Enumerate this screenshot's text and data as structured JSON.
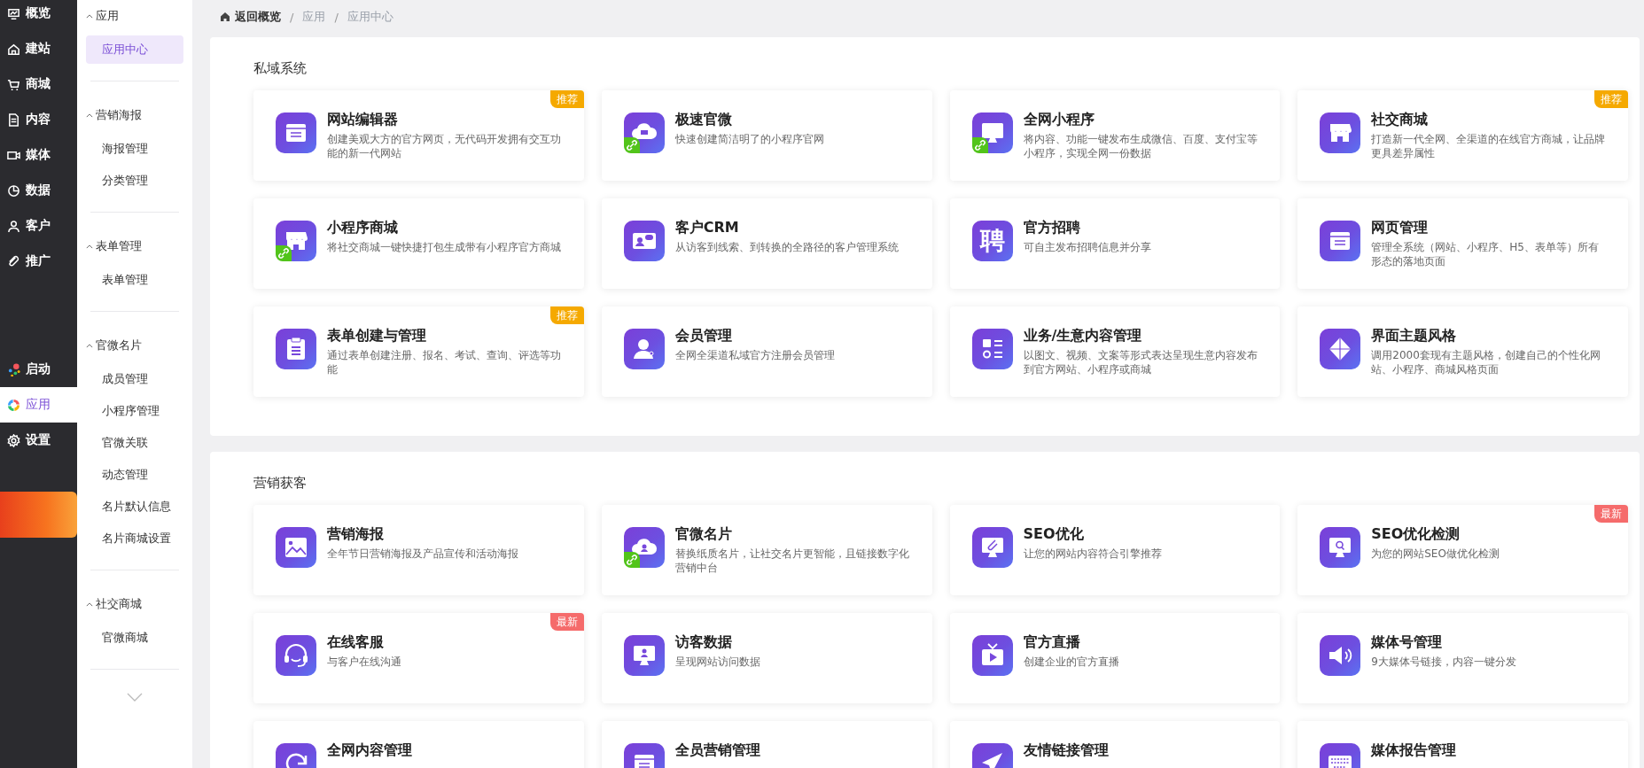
{
  "main_nav": {
    "top": [
      {
        "label": "概览",
        "selected": false
      },
      {
        "label": "建站",
        "selected": false
      },
      {
        "label": "商城",
        "selected": false
      },
      {
        "label": "内容",
        "selected": false
      },
      {
        "label": "媒体",
        "selected": false
      },
      {
        "label": "数据",
        "selected": false
      },
      {
        "label": "客户",
        "selected": false
      },
      {
        "label": "推广",
        "selected": false
      }
    ],
    "bottom": [
      {
        "label": "启动",
        "selected": false
      },
      {
        "label": "应用",
        "selected": true
      },
      {
        "label": "设置",
        "selected": false
      }
    ]
  },
  "sub_nav": [
    {
      "label": "应用",
      "expanded": true,
      "items": [
        {
          "label": "应用中心",
          "selected": true
        }
      ]
    },
    {
      "label": "营销海报",
      "expanded": true,
      "items": [
        {
          "label": "海报管理",
          "selected": false
        },
        {
          "label": "分类管理",
          "selected": false
        }
      ]
    },
    {
      "label": "表单管理",
      "expanded": true,
      "items": [
        {
          "label": "表单管理",
          "selected": false
        }
      ]
    },
    {
      "label": "官微名片",
      "expanded": true,
      "items": [
        {
          "label": "成员管理",
          "selected": false
        },
        {
          "label": "小程序管理",
          "selected": false
        },
        {
          "label": "官微关联",
          "selected": false
        },
        {
          "label": "动态管理",
          "selected": false
        },
        {
          "label": "名片默认信息",
          "selected": false
        },
        {
          "label": "名片商城设置",
          "selected": false
        }
      ]
    },
    {
      "label": "社交商城",
      "expanded": true,
      "items": [
        {
          "label": "官微商城",
          "selected": false
        }
      ]
    }
  ],
  "breadcrumb": {
    "home": "返回概览",
    "separator": "/",
    "items": [
      "应用",
      "应用中心"
    ]
  },
  "sections": [
    {
      "title": "私域系统",
      "cards": [
        {
          "title": "网站编辑器",
          "description": "创建美观大方的官方网页，无代码开发拥有交互功能的新一代网站",
          "badge": {
            "text": "推荐",
            "kind": "recommend"
          },
          "mini_program": false
        },
        {
          "title": "极速官微",
          "description": "快速创建简洁明了的小程序官网",
          "mini_program": true
        },
        {
          "title": "全网小程序",
          "description": "将内容、功能一键发布生成微信、百度、支付宝等小程序，实现全网一份数据",
          "mini_program": true
        },
        {
          "title": "社交商城",
          "description": "打造新一代全网、全渠道的在线官方商城，让品牌更具差异属性",
          "badge": {
            "text": "推荐",
            "kind": "recommend"
          },
          "mini_program": false
        },
        {
          "title": "小程序商城",
          "description": "将社交商城一键快捷打包生成带有小程序官方商城",
          "mini_program": true
        },
        {
          "title": "客户CRM",
          "description": "从访客到线索、到转换的全路径的客户管理系统",
          "mini_program": false
        },
        {
          "title": "官方招聘",
          "description": "可自主发布招聘信息并分享",
          "icon_glyph": "聘",
          "mini_program": false
        },
        {
          "title": "网页管理",
          "description": "管理全系统（网站、小程序、H5、表单等）所有形态的落地页面",
          "mini_program": false
        },
        {
          "title": "表单创建与管理",
          "description": "通过表单创建注册、报名、考试、查询、评选等功能",
          "badge": {
            "text": "推荐",
            "kind": "recommend"
          },
          "mini_program": false
        },
        {
          "title": "会员管理",
          "description": "全网全渠道私域官方注册会员管理",
          "mini_program": false
        },
        {
          "title": "业务/生意内容管理",
          "description": "以图文、视频、文案等形式表达呈现生意内容发布到官方网站、小程序或商城",
          "mini_program": false
        },
        {
          "title": "界面主题风格",
          "description": "调用2000套现有主题风格，创建自己的个性化网站、小程序、商城风格页面",
          "mini_program": false
        }
      ]
    },
    {
      "title": "营销获客",
      "cards": [
        {
          "title": "营销海报",
          "description": "全年节日营销海报及产品宣传和活动海报",
          "mini_program": false
        },
        {
          "title": "官微名片",
          "description": "替换纸质名片，让社交名片更智能，且链接数字化营销中台",
          "mini_program": true
        },
        {
          "title": "SEO优化",
          "description": "让您的网站内容符合引擎推荐",
          "mini_program": false
        },
        {
          "title": "SEO优化检测",
          "description": "为您的网站SEO做优化检测",
          "badge": {
            "text": "最新",
            "kind": "new"
          },
          "mini_program": false
        },
        {
          "title": "在线客服",
          "description": "与客户在线沟通",
          "badge": {
            "text": "最新",
            "kind": "new"
          },
          "mini_program": false
        },
        {
          "title": "访客数据",
          "description": "呈现网站访问数据",
          "mini_program": false
        },
        {
          "title": "官方直播",
          "description": "创建企业的官方直播",
          "mini_program": false
        },
        {
          "title": "媒体号管理",
          "description": "9大媒体号链接，内容一键分发",
          "mini_program": false
        },
        {
          "title": "全网内容管理",
          "mini_program": false
        },
        {
          "title": "全员营销管理",
          "mini_program": false
        },
        {
          "title": "友情链接管理",
          "mini_program": false
        },
        {
          "title": "媒体报告管理",
          "mini_program": false
        }
      ]
    }
  ]
}
